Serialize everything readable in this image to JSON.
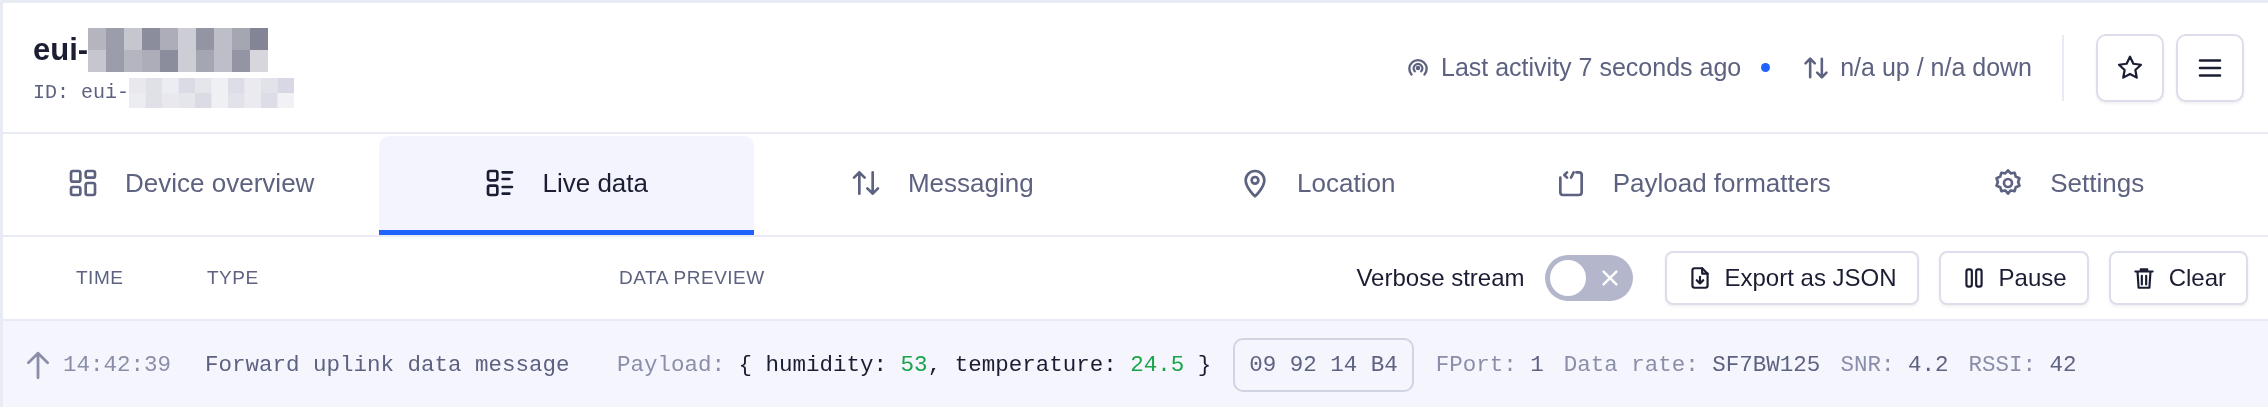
{
  "device": {
    "title": "eui-",
    "id_label": "ID:",
    "id_value": "eui-",
    "last_activity": "Last activity 7 seconds ago",
    "traffic": "n/a up / n/a down"
  },
  "tabs": [
    {
      "label": "Device overview",
      "selected": false
    },
    {
      "label": "Live data",
      "selected": true
    },
    {
      "label": "Messaging",
      "selected": false
    },
    {
      "label": "Location",
      "selected": false
    },
    {
      "label": "Payload formatters",
      "selected": false
    },
    {
      "label": "Settings",
      "selected": false
    }
  ],
  "table": {
    "columns": [
      "TIME",
      "TYPE",
      "DATA PREVIEW"
    ],
    "verbose": {
      "label": "Verbose stream",
      "on": false
    },
    "actions": [
      {
        "label": "Export as JSON"
      },
      {
        "label": "Pause"
      },
      {
        "label": "Clear"
      }
    ],
    "rows": [
      {
        "time": "14:42:39",
        "type": "Forward uplink data message",
        "payload": {
          "label": "Payload:",
          "open": "{",
          "fields": [
            {
              "key": "humidity:",
              "value": "53"
            },
            {
              "key": "temperature:",
              "value": "24.5"
            }
          ],
          "separator": ",",
          "close": "}"
        },
        "bytes": "09 92 14 B4",
        "meta": [
          {
            "label": "FPort:",
            "value": "1"
          },
          {
            "label": "Data rate:",
            "value": "SF7BW125"
          },
          {
            "label": "SNR:",
            "value": "4.2"
          },
          {
            "label": "RSSI:",
            "value": "42"
          }
        ]
      }
    ]
  }
}
